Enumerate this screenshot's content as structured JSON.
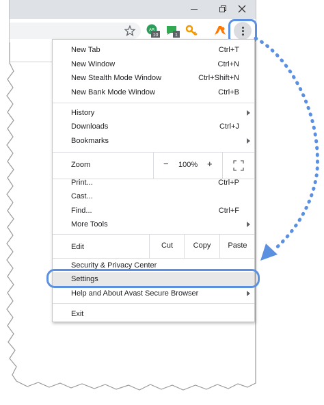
{
  "window": {
    "minimize_glyph": "—",
    "restore_glyph": "⧉",
    "close_glyph": "✕"
  },
  "toolbar": {
    "ext_badge_1": "10",
    "ext_badge_2": "1",
    "ext_ab_text": "AB"
  },
  "menu": {
    "new_tab": "New Tab",
    "new_tab_sc": "Ctrl+T",
    "new_window": "New Window",
    "new_window_sc": "Ctrl+N",
    "stealth": "New Stealth Mode Window",
    "stealth_sc": "Ctrl+Shift+N",
    "bank": "New Bank Mode Window",
    "bank_sc": "Ctrl+B",
    "history": "History",
    "downloads": "Downloads",
    "downloads_sc": "Ctrl+J",
    "bookmarks": "Bookmarks",
    "zoom": "Zoom",
    "zoom_minus": "−",
    "zoom_value": "100%",
    "zoom_plus": "+",
    "print": "Print...",
    "print_sc": "Ctrl+P",
    "cast": "Cast...",
    "find": "Find...",
    "find_sc": "Ctrl+F",
    "more_tools": "More Tools",
    "edit": "Edit",
    "cut": "Cut",
    "copy": "Copy",
    "paste": "Paste",
    "security": "Security & Privacy Center",
    "settings": "Settings",
    "help": "Help and About Avast Secure Browser",
    "exit": "Exit"
  },
  "colors": {
    "highlight_outline": "#5b8fe0",
    "menu_hover": "#e8e8e8",
    "titlebar": "#dee1e6"
  }
}
